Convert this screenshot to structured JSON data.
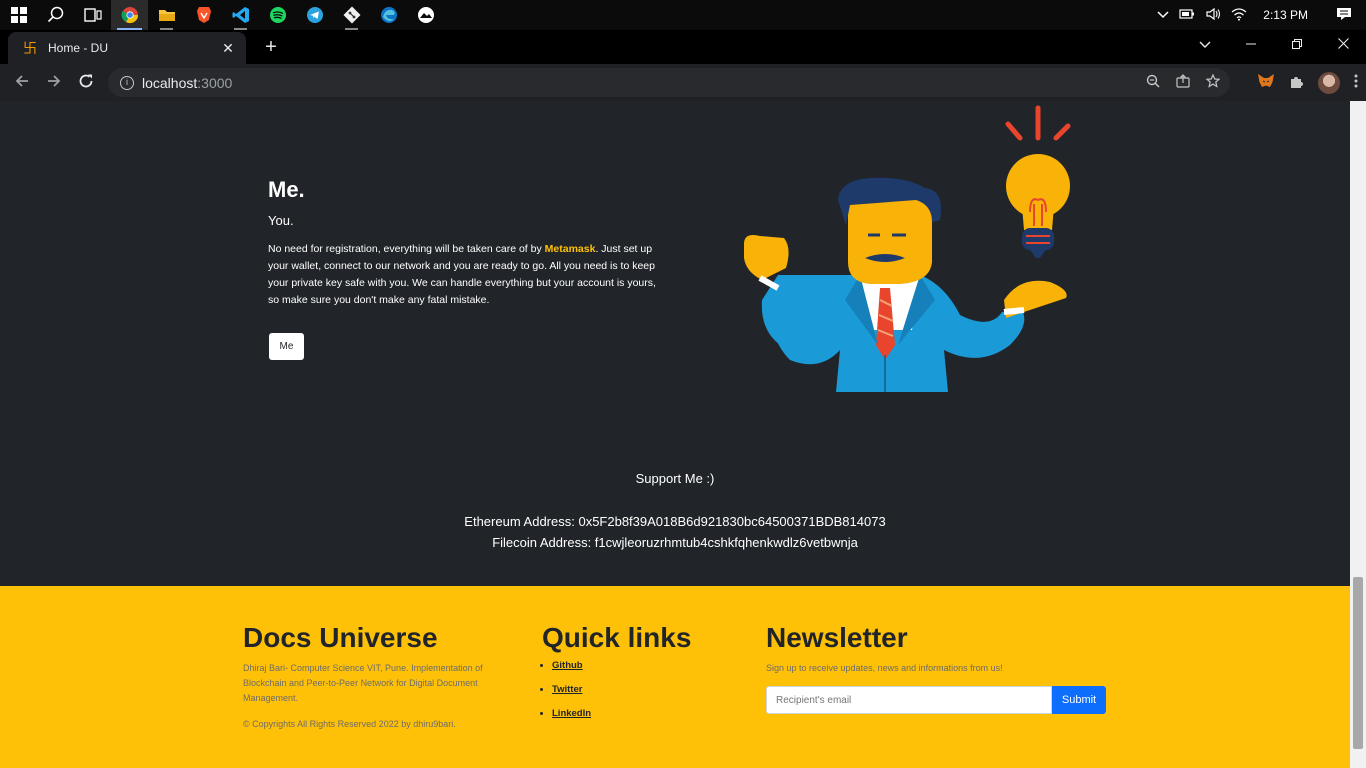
{
  "taskbar": {
    "clock": "2:13 PM",
    "apps": [
      "windows-start",
      "search",
      "task-view",
      "chrome",
      "file-explorer",
      "brave",
      "vscode",
      "spotify",
      "telegram",
      "git",
      "edge",
      "notes"
    ]
  },
  "browser": {
    "tab_title": "Home - DU",
    "tab_favicon": "卐",
    "url_host": "localhost",
    "url_port": ":3000"
  },
  "hero": {
    "heading": "Me.",
    "subheading": "You.",
    "text_before": "No need for registration, everything will be taken care of by ",
    "brand": "Metamask",
    "text_after": ". Just set up your wallet, connect to our network and you are ready to go. All you need is to keep your private key safe with you. We can handle everything but your account is yours, so make sure you don't make any fatal mistake.",
    "button_label": "Me"
  },
  "support": {
    "title": "Support Me :)",
    "eth": "Ethereum Address: 0x5F2b8f39A018B6d921830bc64500371BDB814073",
    "fil": "Filecoin Address: f1cwjleoruzrhmtub4cshkfqhenkwdlz6vetbwnja"
  },
  "footer": {
    "brand_title": "Docs Universe",
    "brand_desc": "Dhiraj Bari- Computer Science VIT, Pune. Implementation of Blockchain and Peer-to-Peer Network for Digital Document Management.",
    "copyright": "© Copyrights All Rights Reserved 2022 by dhiru9bari.",
    "links_title": "Quick links",
    "links": [
      "Github",
      "Twitter",
      "LinkedIn"
    ],
    "newsletter_title": "Newsletter",
    "newsletter_desc": "Sign up to receive updates, news and informations from us!",
    "email_placeholder": "Recipient's email",
    "submit_label": "Submit"
  },
  "colors": {
    "page_bg": "#212529",
    "accent": "#ffc107",
    "submit": "#0d6efd"
  }
}
